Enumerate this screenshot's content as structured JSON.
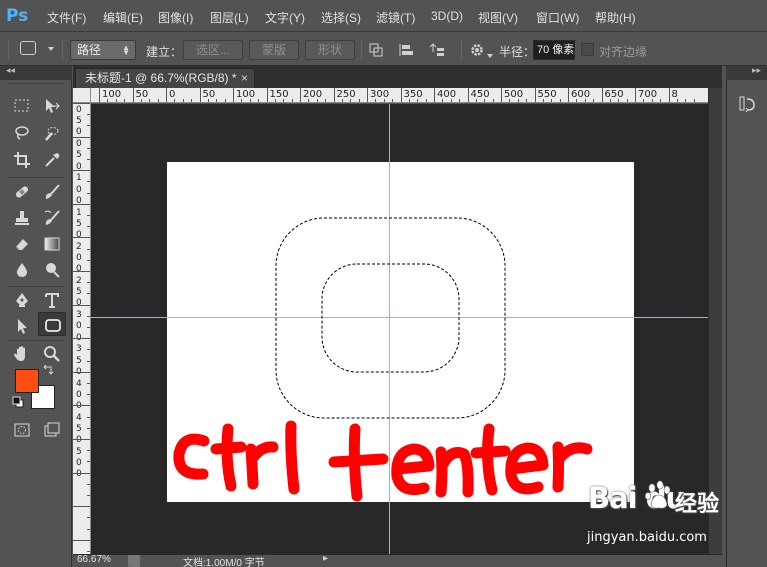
{
  "app": {
    "logo": "Ps"
  },
  "menu": [
    {
      "label": "文件(F)"
    },
    {
      "label": "编辑(E)"
    },
    {
      "label": "图像(I)"
    },
    {
      "label": "图层(L)"
    },
    {
      "label": "文字(Y)"
    },
    {
      "label": "选择(S)"
    },
    {
      "label": "滤镜(T)"
    },
    {
      "label": "3D(D)"
    },
    {
      "label": "视图(V)"
    },
    {
      "label": "窗口(W)"
    },
    {
      "label": "帮助(H)"
    }
  ],
  "options": {
    "mode_value": "路径",
    "make_label": "建立：",
    "selection_button": "选区...",
    "mask_button": "蒙版",
    "shape_button": "形状",
    "radius_label": "半径：",
    "radius_value": "70 像素",
    "align_edges_label": "对齐边缘"
  },
  "document": {
    "tab_title": "未标题-1 @ 66.7%(RGB/8) *",
    "close_glyph": "×"
  },
  "ruler": {
    "h_labels": [
      "100",
      "50",
      "0",
      "50",
      "100",
      "150",
      "200",
      "250",
      "300",
      "350",
      "400",
      "450",
      "500",
      "550",
      "600",
      "650",
      "700",
      "8"
    ],
    "v_labels": [
      "0",
      "5",
      "0",
      "0",
      "5",
      "0",
      "1",
      "0",
      "0",
      "1",
      "5",
      "0",
      "2",
      "0",
      "0",
      "2",
      "5",
      "0",
      "3",
      "0",
      "0",
      "3",
      "5",
      "0",
      "4",
      "0",
      "0",
      "4",
      "5",
      "0",
      "5",
      "0",
      "0"
    ]
  },
  "annotation": {
    "handwritten_text": "ctrl+enter"
  },
  "colors": {
    "foreground": "#ff4e12",
    "background": "#ffffff",
    "guide": "#4fd8e4",
    "annotation": "#ff0000"
  },
  "status": {
    "zoom": "66.67%",
    "doc_info": "文档:1.00M/0 字节",
    "arrow": "▸"
  },
  "panels": {
    "collapse_left": "◂◂",
    "collapse_right": "▸▸"
  },
  "watermark": {
    "brand": "Bai du",
    "product": "经验",
    "url": "jingyan.baidu.com"
  }
}
